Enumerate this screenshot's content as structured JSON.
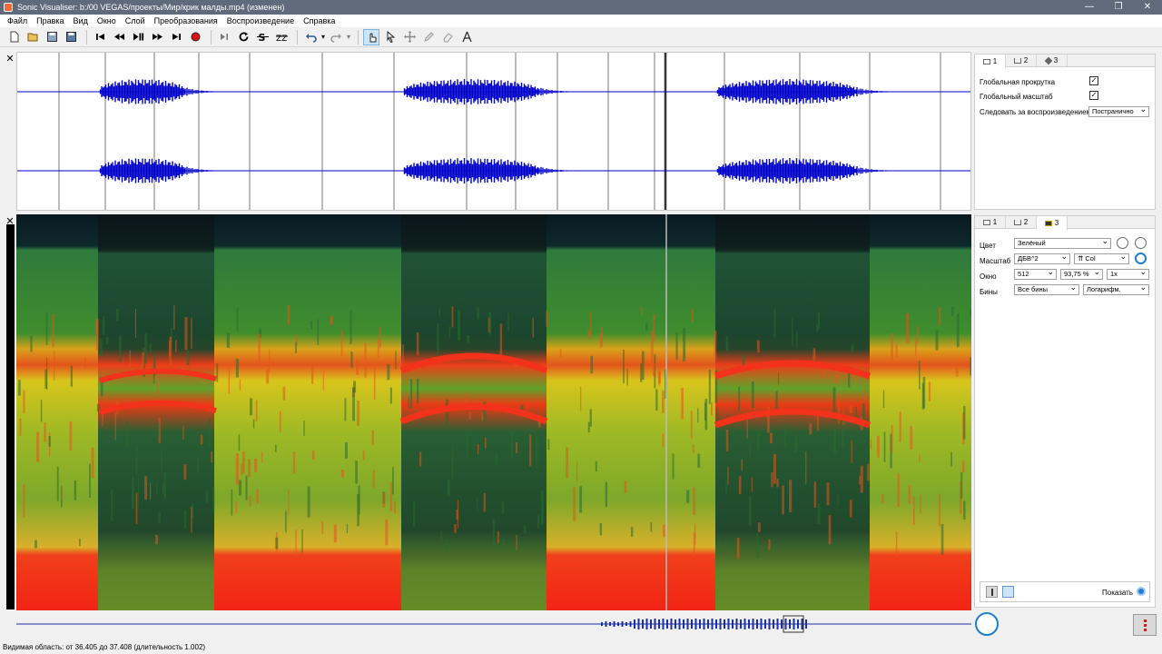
{
  "window": {
    "title": "Sonic Visualiser: b:/00 VEGAS/проекты/Мир/крик малды.mp4 (изменен)",
    "controls": [
      "—",
      "❐",
      "✕"
    ]
  },
  "menu": [
    "Файл",
    "Правка",
    "Вид",
    "Окно",
    "Слой",
    "Преобразования",
    "Воспроизведение",
    "Справка"
  ],
  "toolbar": {
    "icons": [
      "new-file",
      "open-file",
      "save",
      "save-as",
      "rewind-start",
      "rewind",
      "play-pause",
      "fast-forward",
      "forward-end",
      "record",
      "play-selection",
      "loop",
      "solo",
      "speed",
      "undo",
      "redo",
      "navigate",
      "select",
      "move",
      "draw",
      "erase",
      "measure"
    ],
    "selected_tool": "navigate"
  },
  "panel1": {
    "tabs": [
      "1",
      "2",
      "3"
    ],
    "global_scroll_label": "Глобальная прокрутка",
    "global_scroll_checked": true,
    "global_zoom_label": "Глобальный масштаб",
    "global_zoom_checked": true,
    "follow_label": "Следовать за воспроизведением",
    "follow_value": "Постранично"
  },
  "panel2": {
    "tabs": [
      "1",
      "2",
      "3"
    ],
    "color_label": "Цвет",
    "color_value": "Зелёный",
    "scale_label": "Масштаб",
    "scale_value": "ДБВ^2",
    "norm_value": "Col",
    "window_label": "Окно",
    "window_value": "512",
    "overlap_value": "93,75 %",
    "oversample_value": "1x",
    "bins_label": "Бины",
    "bins_value": "Все бины",
    "bins_scale_value": "Логарифм.",
    "show_label": "Показать"
  },
  "status": {
    "text": "Видимая область: от 36.405 до 37.408 (длительность 1.002)"
  },
  "colors": {
    "waveform": "#0000cc",
    "titlebar": "#5f6b7a",
    "accent": "#1e7fd0"
  }
}
